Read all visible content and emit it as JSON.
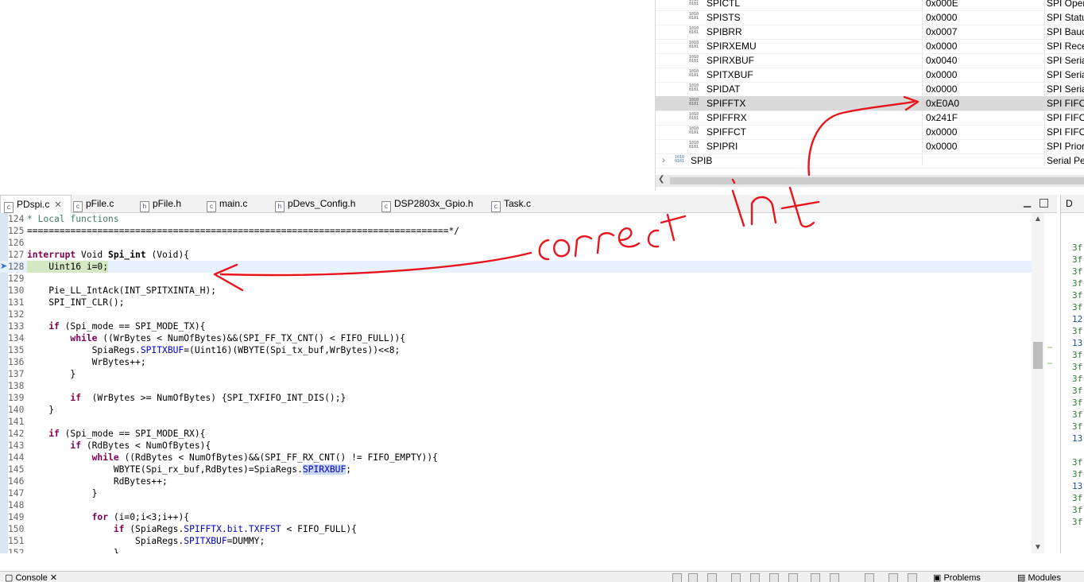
{
  "registers": {
    "rows": [
      {
        "name": "SPICTL",
        "value": "0x000E",
        "desc": "SPI Opera"
      },
      {
        "name": "SPISTS",
        "value": "0x0000",
        "desc": "SPI Status"
      },
      {
        "name": "SPIBRR",
        "value": "0x0007",
        "desc": "SPI Baud"
      },
      {
        "name": "SPIRXEMU",
        "value": "0x0000",
        "desc": "SPI Recei"
      },
      {
        "name": "SPIRXBUF",
        "value": "0x0040",
        "desc": "SPI Serial"
      },
      {
        "name": "SPITXBUF",
        "value": "0x0000",
        "desc": "SPI Serial"
      },
      {
        "name": "SPIDAT",
        "value": "0x0000",
        "desc": "SPI Serial"
      },
      {
        "name": "SPIFFTX",
        "value": "0xE0A0",
        "desc": "SPI FIFO T"
      },
      {
        "name": "SPIFFRX",
        "value": "0x241F",
        "desc": "SPI FIFO R"
      },
      {
        "name": "SPIFFCT",
        "value": "0x0000",
        "desc": "SPI FIFO C"
      },
      {
        "name": "SPIPRI",
        "value": "0x0000",
        "desc": "SPI Priorit"
      }
    ],
    "selected_row": "SPIFFTX",
    "group": {
      "name": "SPIB",
      "value": "",
      "desc": "Serial Per"
    },
    "icon_text": "1010 0101"
  },
  "tabs": [
    {
      "label": "PDspi.c",
      "icon": "c",
      "active": true
    },
    {
      "label": "pFile.c",
      "icon": "c"
    },
    {
      "label": "pFile.h",
      "icon": "h"
    },
    {
      "label": "main.c",
      "icon": "c"
    },
    {
      "label": "pDevs_Config.h",
      "icon": "h"
    },
    {
      "label": "DSP2803x_Gpio.h",
      "icon": "c"
    },
    {
      "label": "Task.c",
      "icon": "c"
    }
  ],
  "tab_close_glyph": "✕",
  "code_lines": [
    {
      "n": "124",
      "t": "* Local functions"
    },
    {
      "n": "125",
      "t": "==============================================================================*/"
    },
    {
      "n": "126",
      "t": ""
    },
    {
      "n": "127",
      "t": "interrupt Void Spi_int (Void){"
    },
    {
      "n": "128",
      "t": "    Uint16 i=0;"
    },
    {
      "n": "129",
      "t": ""
    },
    {
      "n": "130",
      "t": "    Pie_LL_IntAck(INT_SPITXINTA_H);"
    },
    {
      "n": "131",
      "t": "    SPI_INT_CLR();"
    },
    {
      "n": "132",
      "t": ""
    },
    {
      "n": "133",
      "t": "    if (Spi_mode == SPI_MODE_TX){"
    },
    {
      "n": "134",
      "t": "        while ((WrBytes < NumOfBytes)&&(SPI_FF_TX_CNT() < FIFO_FULL)){"
    },
    {
      "n": "135",
      "t": "            SpiaRegs.SPITXBUF=(Uint16)(WBYTE(Spi_tx_buf,WrBytes))<<8;"
    },
    {
      "n": "136",
      "t": "            WrBytes++;"
    },
    {
      "n": "137",
      "t": "        }"
    },
    {
      "n": "138",
      "t": ""
    },
    {
      "n": "139",
      "t": "        if  (WrBytes >= NumOfBytes) {SPI_TXFIFO_INT_DIS();}"
    },
    {
      "n": "140",
      "t": "    }"
    },
    {
      "n": "141",
      "t": ""
    },
    {
      "n": "142",
      "t": "    if (Spi_mode == SPI_MODE_RX){"
    },
    {
      "n": "143",
      "t": "        if (RdBytes < NumOfBytes){"
    },
    {
      "n": "144",
      "t": "            while ((RdBytes < NumOfBytes)&&(SPI_FF_RX_CNT() != FIFO_EMPTY)){"
    },
    {
      "n": "145",
      "t": "                WBYTE(Spi_rx_buf,RdBytes)=SpiaRegs.SPIRXBUF;"
    },
    {
      "n": "146",
      "t": "                RdBytes++;"
    },
    {
      "n": "147",
      "t": "            }"
    },
    {
      "n": "148",
      "t": ""
    },
    {
      "n": "149",
      "t": "            for (i=0;i<3;i++){"
    },
    {
      "n": "150",
      "t": "                if (SpiaRegs.SPIFFTX.bit.TXFFST < FIFO_FULL){"
    },
    {
      "n": "151",
      "t": "                    SpiaRegs.SPITXBUF=DUMMY;"
    },
    {
      "n": "152",
      "t": "                }"
    }
  ],
  "current_line": "128",
  "right_panel": {
    "tab_label": "D",
    "lines": [
      "3f",
      "3f",
      "3f",
      "3f",
      "3f",
      "3f",
      "12",
      "3f",
      "13",
      "3f",
      "3f",
      "3f",
      "3f",
      "3f",
      "3f",
      "3f",
      "13",
      "",
      "3f",
      "3f",
      "13",
      "3f",
      "3f",
      "3f"
    ]
  },
  "bottom_bar": {
    "console_label": "Console",
    "problems_label": "Problems",
    "modules_label": "Modules"
  },
  "annotation": {
    "text": "correct int",
    "color": "#e8141c"
  },
  "colors": {
    "keyword": "#7f0055",
    "comment": "#3f7f5f",
    "field": "#0000c0",
    "selected_row": "#dadada"
  }
}
